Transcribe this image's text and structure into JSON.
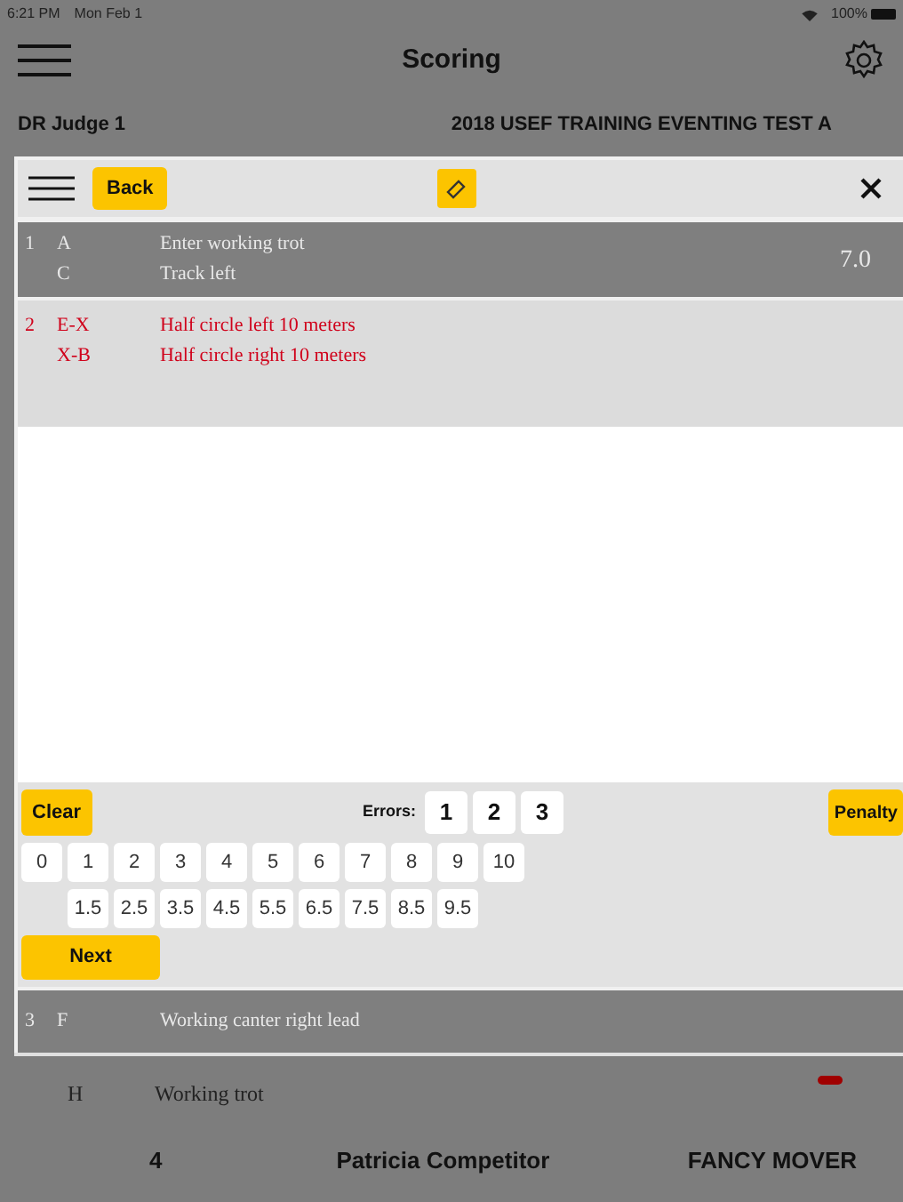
{
  "status_bar": {
    "time": "6:21 PM",
    "date": "Mon Feb 1",
    "battery": "100%"
  },
  "header": {
    "title": "Scoring"
  },
  "subheader": {
    "judge": "DR Judge 1",
    "test": "2018 USEF TRAINING EVENTING TEST A"
  },
  "toolbar": {
    "back": "Back"
  },
  "movements": [
    {
      "number": "1",
      "markers": [
        "A",
        "C"
      ],
      "texts": [
        "Enter working trot",
        "Track left"
      ],
      "score": "7.0",
      "selected": false
    },
    {
      "number": "2",
      "markers": [
        "E-X",
        "X-B"
      ],
      "texts": [
        "Half circle left 10 meters",
        "Half circle right 10 meters"
      ],
      "selected": true
    }
  ],
  "controls": {
    "clear": "Clear",
    "errors_label": "Errors:",
    "errors": [
      "1",
      "2",
      "3"
    ],
    "penalty": "Penalty",
    "scores": [
      "0",
      "1",
      "2",
      "3",
      "4",
      "5",
      "6",
      "7",
      "8",
      "9",
      "10"
    ],
    "half_scores": [
      "1.5",
      "2.5",
      "3.5",
      "4.5",
      "5.5",
      "6.5",
      "7.5",
      "8.5",
      "9.5"
    ],
    "next": "Next"
  },
  "next_movement": {
    "number": "3",
    "markers": [
      "F"
    ],
    "texts": [
      "Working canter right lead"
    ]
  },
  "background_row": {
    "marker": "H",
    "text": "Working trot"
  },
  "footer": {
    "number": "4",
    "rider": "Patricia Competitor",
    "horse": "FANCY MOVER"
  }
}
